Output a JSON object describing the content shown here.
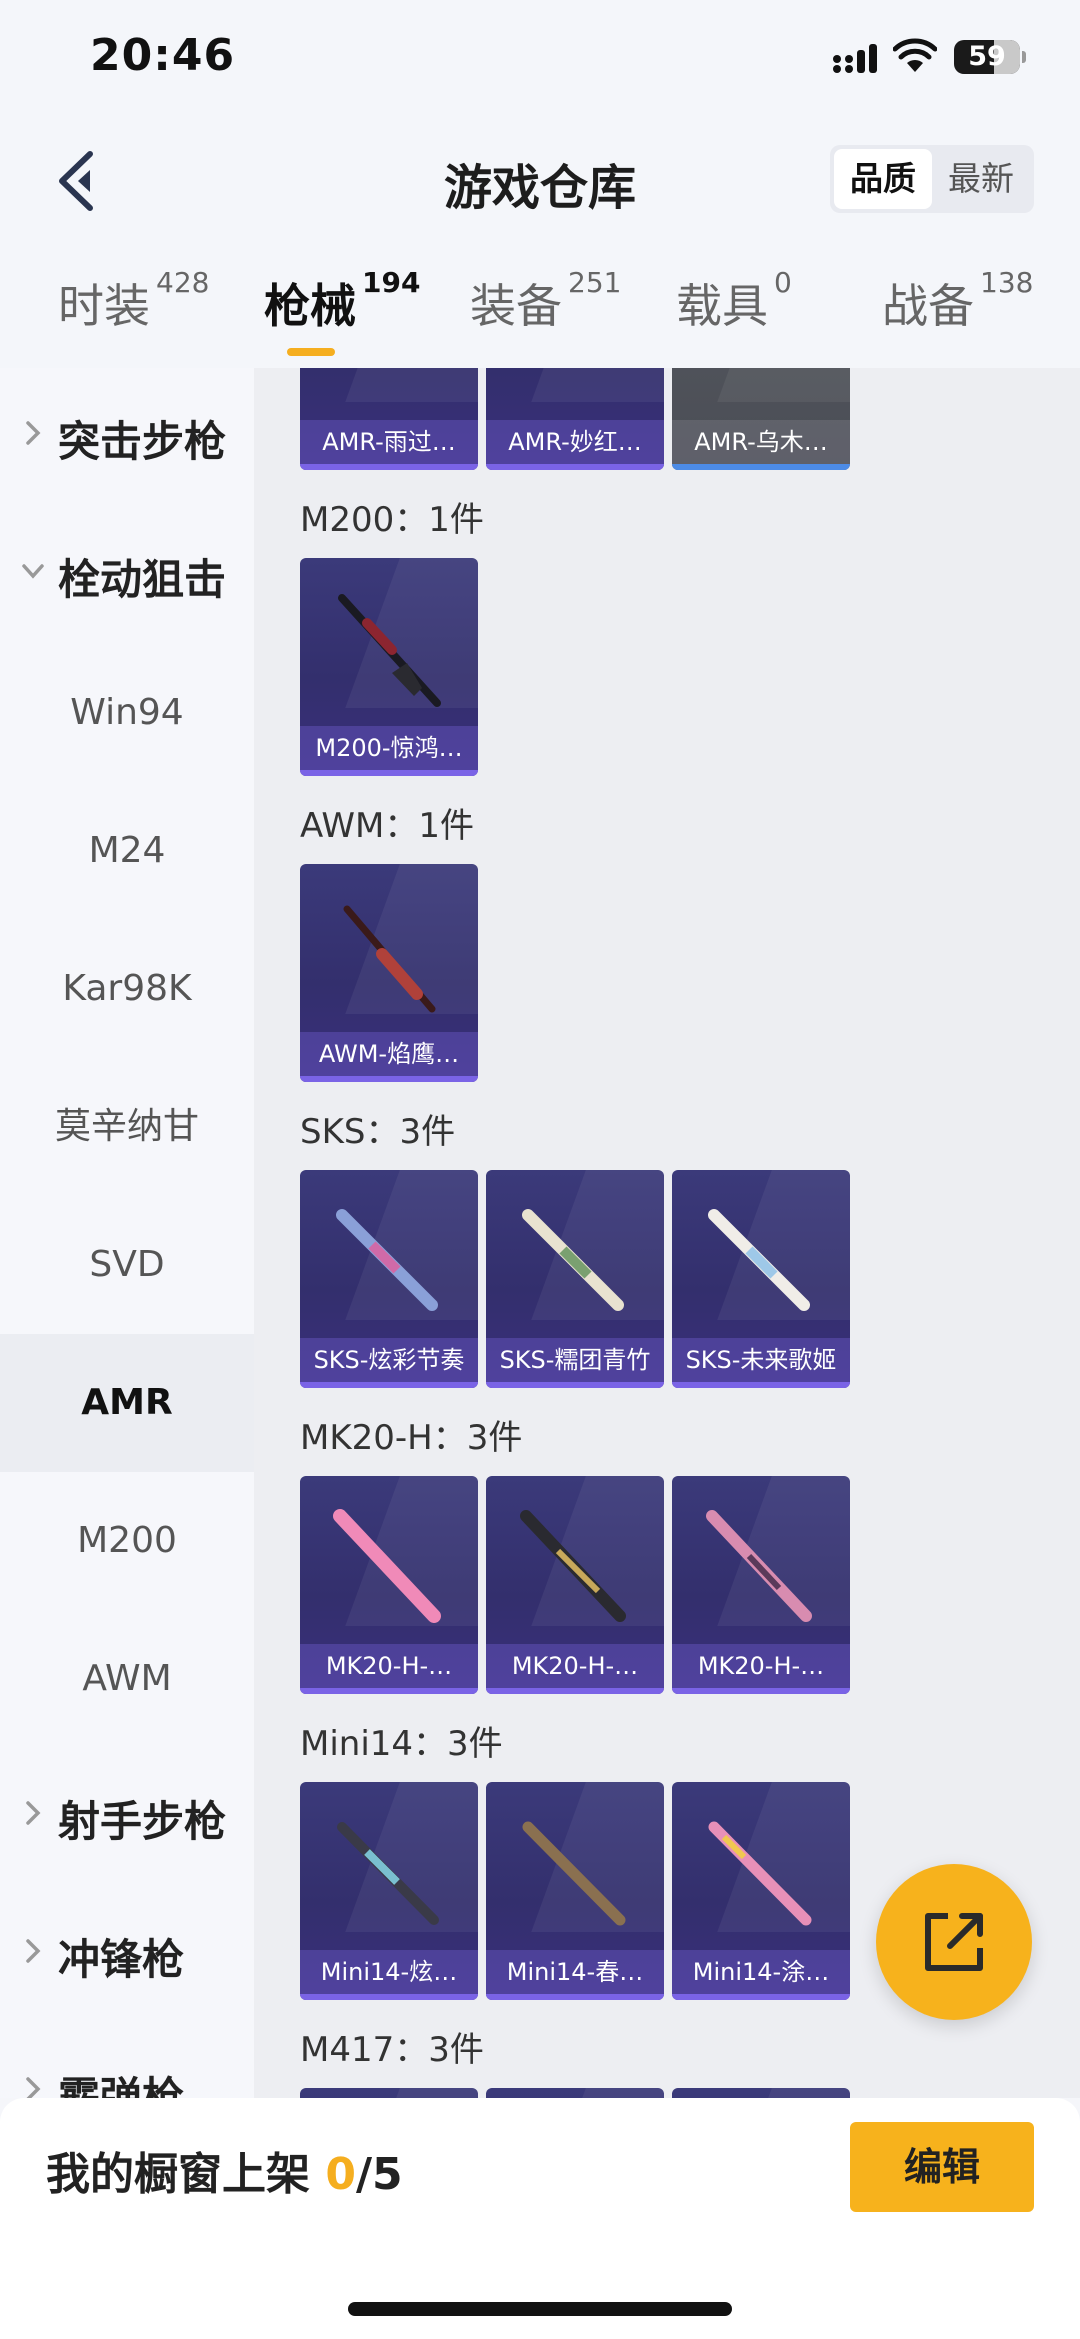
{
  "status_bar": {
    "time": "20:46",
    "battery": "59"
  },
  "header": {
    "title": "游戏仓库",
    "sort_options": [
      "品质",
      "最新"
    ],
    "sort_selected": "品质"
  },
  "tabs": [
    {
      "label": "时装",
      "count": "428"
    },
    {
      "label": "枪械",
      "count": "194"
    },
    {
      "label": "装备",
      "count": "251"
    },
    {
      "label": "载具",
      "count": "0"
    },
    {
      "label": "战备",
      "count": "138"
    }
  ],
  "active_tab": "枪械",
  "sidebar": {
    "group_assault": "突击步枪",
    "group_sniper": "栓动狙击",
    "items": [
      "Win94",
      "M24",
      "Kar98K",
      "莫辛纳甘",
      "SVD",
      "AMR",
      "M200",
      "AWM"
    ],
    "active_item": "AMR",
    "group_marksman": "射手步枪",
    "group_smg": "冲锋枪",
    "group_shotgun": "霰弹枪"
  },
  "content": {
    "top_cards": [
      "AMR-雨过…",
      "AMR-妙红…",
      "AMR-乌木…"
    ],
    "sections": [
      {
        "title": "M200：1件",
        "cards": [
          "M200-惊鸿…"
        ]
      },
      {
        "title": "AWM：1件",
        "cards": [
          "AWM-焰鹰…"
        ]
      },
      {
        "title": "SKS：3件",
        "cards": [
          "SKS-炫彩节奏",
          "SKS-糯团青竹",
          "SKS-未来歌姬"
        ]
      },
      {
        "title": "MK20-H：3件",
        "cards": [
          "MK20-H-…",
          "MK20-H-…",
          "MK20-H-…"
        ]
      },
      {
        "title": "Mini14：3件",
        "cards": [
          "Mini14-炫…",
          "Mini14-春…",
          "Mini14-涂…"
        ]
      },
      {
        "title": "M417：3件",
        "cards": []
      }
    ]
  },
  "bottom_bar": {
    "label": "我的橱窗上架 ",
    "current": "0",
    "total": "/5",
    "edit_label": "编辑"
  },
  "colors": {
    "accent": "#f7b21c",
    "card_bg": "#332f6d",
    "card_bar": "#7a63e6"
  },
  "icons": {
    "back": "chevron-left-icon",
    "fab": "share-out-icon"
  }
}
